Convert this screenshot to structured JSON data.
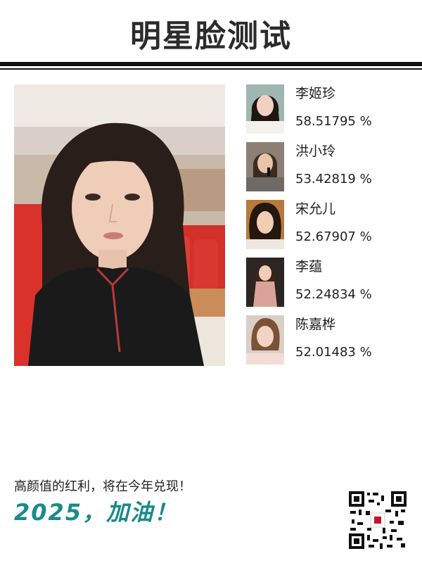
{
  "header": {
    "title": "明星脸测试"
  },
  "main_photo": {
    "icon": "portrait-photo"
  },
  "matches": [
    {
      "name": "李姬珍",
      "score": "58.51795 %"
    },
    {
      "name": "洪小玲",
      "score": "53.42819 %"
    },
    {
      "name": "宋允儿",
      "score": "52.67907 %"
    },
    {
      "name": "李蕴",
      "score": "52.24834 %"
    },
    {
      "name": "陈嘉桦",
      "score": "52.01483 %"
    }
  ],
  "footer": {
    "tagline": "高颜值的红利，将在今年兑现！",
    "slogan": "2025，加油！",
    "qr_icon": "qr-code"
  },
  "colors": {
    "accent": "#1a8a8a",
    "text": "#222222",
    "rule": "#111111"
  }
}
